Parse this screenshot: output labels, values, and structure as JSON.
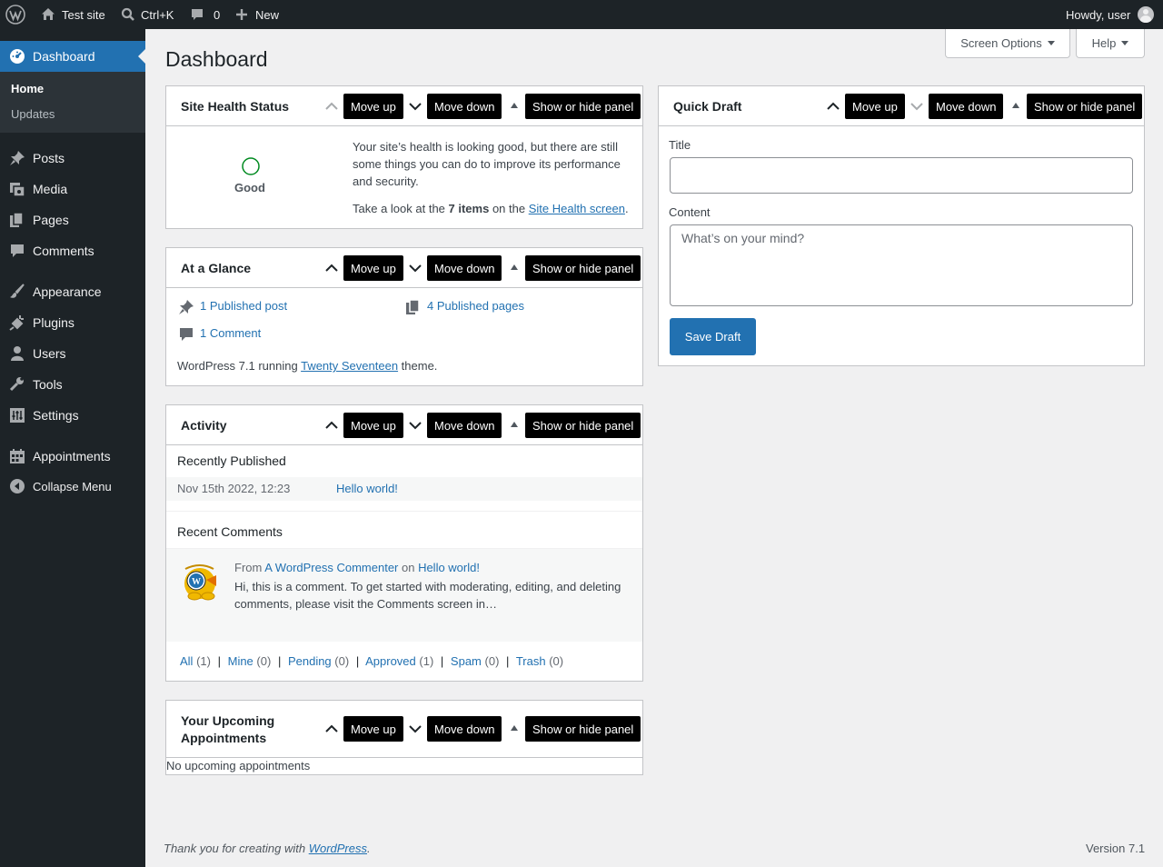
{
  "adminbar": {
    "site_name": "Test site",
    "search_shortcut": "Ctrl+K",
    "comments_count": "0",
    "new_label": "New",
    "howdy": "Howdy, user"
  },
  "sidebar": {
    "dashboard": "Dashboard",
    "submenu": [
      "Home",
      "Updates"
    ],
    "items": [
      "Posts",
      "Media",
      "Pages",
      "Comments",
      "Appearance",
      "Plugins",
      "Users",
      "Tools",
      "Settings",
      "Appointments"
    ],
    "collapse": "Collapse Menu"
  },
  "page": {
    "title": "Dashboard",
    "screen_options": "Screen Options",
    "help": "Help"
  },
  "controls": {
    "move_up": "Move up",
    "move_down": "Move down",
    "toggle": "Show or hide panel"
  },
  "site_health": {
    "title": "Site Health Status",
    "status": "Good",
    "message": "Your site’s health is looking good, but there are still some things you can do to improve its performance and security.",
    "look_prefix": "Take a look at the ",
    "items_count": "7 items",
    "look_mid": " on the ",
    "screen_link": "Site Health screen",
    "look_suffix": "."
  },
  "at_a_glance": {
    "title": "At a Glance",
    "posts": "1 Published post",
    "pages": "4 Published pages",
    "comments": "1 Comment",
    "version_prefix": "WordPress 7.1 running ",
    "theme": "Twenty Seventeen",
    "version_suffix": " theme."
  },
  "activity": {
    "title": "Activity",
    "recently_published": "Recently Published",
    "post_date": "Nov 15th 2022, 12:23",
    "post_title": "Hello world!",
    "recent_comments": "Recent Comments",
    "comment_from": "From ",
    "comment_author": "A WordPress Commenter",
    "comment_on": " on ",
    "comment_post": "Hello world!",
    "comment_text": "Hi, this is a comment. To get started with moderating, editing, and deleting comments, please visit the Comments screen in…",
    "filters": [
      {
        "label": "All",
        "count": "(1)"
      },
      {
        "label": "Mine",
        "count": "(0)"
      },
      {
        "label": "Pending",
        "count": "(0)"
      },
      {
        "label": "Approved",
        "count": "(1)"
      },
      {
        "label": "Spam",
        "count": "(0)"
      },
      {
        "label": "Trash",
        "count": "(0)"
      }
    ],
    "separator": "|"
  },
  "appointments": {
    "title": "Your Upcoming Appointments",
    "empty": "No upcoming appointments"
  },
  "quick_draft": {
    "title": "Quick Draft",
    "title_label": "Title",
    "title_value": "",
    "content_label": "Content",
    "content_placeholder": "What’s on your mind?",
    "save": "Save Draft"
  },
  "footer": {
    "thanks_prefix": "Thank you for creating with ",
    "wordpress": "WordPress",
    "thanks_suffix": ".",
    "version": "Version 7.1"
  },
  "colors": {
    "admin_bar": "#1d2327",
    "accent": "#2271b1",
    "health_good": "#008a20"
  }
}
